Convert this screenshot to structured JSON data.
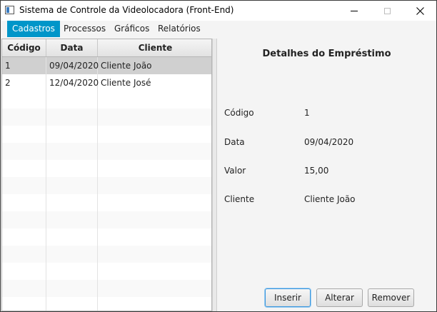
{
  "window": {
    "title": "Sistema de Controle da Videolocadora (Front-End)"
  },
  "menu": {
    "items": [
      {
        "label": "Cadastros",
        "active": true
      },
      {
        "label": "Processos",
        "active": false
      },
      {
        "label": "Gráficos",
        "active": false
      },
      {
        "label": "Relatórios",
        "active": false
      }
    ]
  },
  "table": {
    "columns": [
      "Código",
      "Data",
      "Cliente"
    ],
    "rows": [
      {
        "codigo": "1",
        "data": "09/04/2020",
        "cliente": "Cliente João",
        "selected": true
      },
      {
        "codigo": "2",
        "data": "12/04/2020",
        "cliente": "Cliente José",
        "selected": false
      }
    ]
  },
  "details": {
    "title": "Detalhes do Empréstimo",
    "codigo_label": "Código",
    "codigo_value": "1",
    "data_label": "Data",
    "data_value": "09/04/2020",
    "valor_label": "Valor",
    "valor_value": "15,00",
    "cliente_label": "Cliente",
    "cliente_value": "Cliente João"
  },
  "buttons": {
    "inserir": "Inserir",
    "alterar": "Alterar",
    "remover": "Remover"
  },
  "colors": {
    "menu_active": "#0096c9",
    "selection": "#d0d0d0"
  }
}
